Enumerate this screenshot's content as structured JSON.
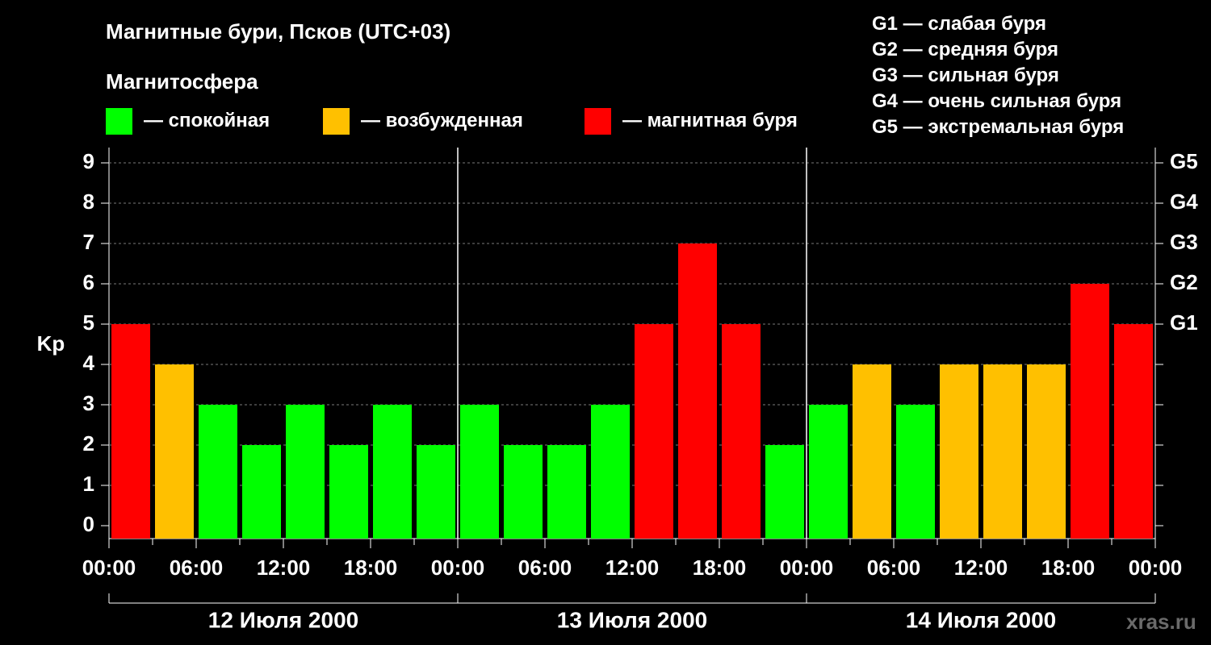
{
  "chart_data": {
    "type": "bar",
    "title": "Магнитные бури, Псков (UTC+03)",
    "subtitle": "Магнитосфера",
    "legend": [
      {
        "label": "— спокойная",
        "color": "#00ff00"
      },
      {
        "label": "— возбужденная",
        "color": "#ffc000"
      },
      {
        "label": "— магнитная буря",
        "color": "#ff0000"
      }
    ],
    "storm_scale": [
      "G1 — слабая буря",
      "G2 — средняя буря",
      "G3 — сильная буря",
      "G4 — очень сильная буря",
      "G5 — экстремальная буря"
    ],
    "ylabel": "Kp",
    "ylim": [
      0,
      9
    ],
    "yticks": [
      "0",
      "1",
      "2",
      "3",
      "4",
      "5",
      "6",
      "7",
      "8",
      "9"
    ],
    "right_axis_labels": [
      {
        "kp": 5,
        "label": "G1"
      },
      {
        "kp": 6,
        "label": "G2"
      },
      {
        "kp": 7,
        "label": "G3"
      },
      {
        "kp": 8,
        "label": "G4"
      },
      {
        "kp": 9,
        "label": "G5"
      }
    ],
    "xtick_labels": [
      "00:00",
      "06:00",
      "12:00",
      "18:00",
      "00:00",
      "06:00",
      "12:00",
      "18:00",
      "00:00",
      "06:00",
      "12:00",
      "18:00",
      "00:00"
    ],
    "days": [
      "12 Июля 2000",
      "13 Июля 2000",
      "14 Июля 2000"
    ],
    "grid": true,
    "values": [
      5,
      4,
      3,
      2,
      3,
      2,
      3,
      2,
      3,
      2,
      2,
      3,
      5,
      7,
      5,
      2,
      3,
      4,
      3,
      4,
      4,
      4,
      6,
      5
    ],
    "colors": {
      "quiet": "#00ff00",
      "active": "#ffc000",
      "storm": "#ff0000"
    }
  },
  "watermark": "xras.ru"
}
